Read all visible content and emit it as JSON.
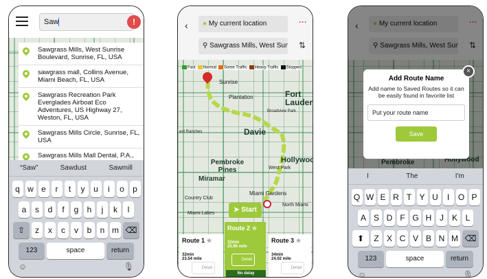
{
  "screen1": {
    "search_value": "Saw",
    "alert_icon": "!",
    "results": [
      "Sawgrass Mills, West Sunrise Boulevard, Sunrise, FL, USA",
      "sawgrass mall, Collins Avenue, Miami Beach, FL, USA",
      "Sawgrass Recreation Park Everglades Airboat Eco Adventures, US Highway 27, Weston, FL, USA",
      "Sawgrass Mills Circle, Sunrise, FL, USA",
      "Sawgrass Mills Mall Dental, P.A., West Sunrise Boulevard, Sunrise, FL, USA"
    ],
    "suggestions": [
      "“Saw”",
      "Sawdust",
      "Sawmill"
    ],
    "keys_row1": [
      "q",
      "w",
      "e",
      "r",
      "t",
      "y",
      "u",
      "i",
      "o",
      "p"
    ],
    "keys_row2": [
      "a",
      "s",
      "d",
      "f",
      "g",
      "h",
      "j",
      "k",
      "l"
    ],
    "keys_row3": [
      "z",
      "x",
      "c",
      "v",
      "b",
      "n",
      "m"
    ],
    "key_num": "123",
    "key_space": "space",
    "key_return": "return"
  },
  "screen2": {
    "origin": "My current location",
    "destination": "Sawgrass Mills, West Sunr...",
    "legend": [
      {
        "label": "Fast",
        "color": "#2e9e2e"
      },
      {
        "label": "Normal",
        "color": "#e7c53a"
      },
      {
        "label": "Some Traffic",
        "color": "#e26b1b"
      },
      {
        "label": "Heavy Traffic",
        "color": "#8b3a14"
      },
      {
        "label": "Stopped",
        "color": "#111111"
      }
    ],
    "map_labels": {
      "sunrise": "Sunrise",
      "plantation": "Plantation",
      "fort_lauderdale": "Fort Lauderdale",
      "broadview": "Broadview Park",
      "davie": "Davie",
      "pembroke": "Pembroke Pines",
      "miramar": "Miramar",
      "west_park": "West Park",
      "hollywood": "Hollywood",
      "miami_gardens": "Miami Gardens",
      "north_miami": "North Miami",
      "country_club": "Country Club",
      "miami_lakes": "Miami Lakes",
      "ranches": "est Ranches"
    },
    "start_label": "Start",
    "routes": [
      {
        "name": "Route 1",
        "time": "32min",
        "distance": "23.54 mile",
        "detail": "Detail"
      },
      {
        "name": "Route 2",
        "time": "32min",
        "distance": "25.90 mile",
        "detail": "Detail"
      },
      {
        "name": "Route 3",
        "time": "34min",
        "distance": "24.02 mile",
        "detail": "Detail"
      }
    ],
    "status": "No delay"
  },
  "screen3": {
    "origin": "My current location",
    "destination": "Sawgrass Mills, West Sunr...",
    "dialog_title": "Add Route Name",
    "dialog_text": "Add name to Saved Routes so it can be easily found in favorite list",
    "input_value": "Put your route name",
    "save_label": "Save",
    "close_icon": "×",
    "suggestions": [
      "I",
      "The",
      "I'm"
    ],
    "keys_row1": [
      "Q",
      "W",
      "E",
      "R",
      "T",
      "Y",
      "U",
      "I",
      "O",
      "P"
    ],
    "keys_row2": [
      "A",
      "S",
      "D",
      "F",
      "G",
      "H",
      "J",
      "K",
      "L"
    ],
    "keys_row3": [
      "Z",
      "X",
      "C",
      "V",
      "B",
      "N",
      "M"
    ],
    "map_labels": {
      "pembroke": "Pembroke",
      "hollywood": "Hollywood"
    },
    "key_num": "123",
    "key_space": "space",
    "key_return": "return"
  }
}
